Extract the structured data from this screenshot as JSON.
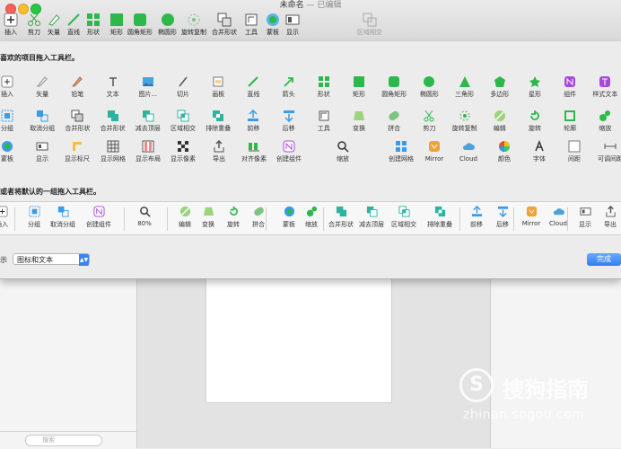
{
  "window": {
    "title": "未命名",
    "subtitle": "— 已编辑"
  },
  "toolbar": {
    "items": [
      "插入",
      "剪刀",
      "矢量",
      "直线",
      "形状",
      "矩形",
      "圆角矩形",
      "椭圆形",
      "旋转复制",
      "合并形状",
      "工具",
      "蒙板",
      "显示"
    ],
    "right_item": "区域相交"
  },
  "sheet": {
    "instruction_top": "喜欢的项目拖入工具栏。",
    "instruction_default": "或者将默认的一组拖入工具栏。",
    "row1": [
      "插入",
      "矢量",
      "铅笔",
      "文本",
      "图片...",
      "切片",
      "画板",
      "直线",
      "箭头",
      "形状",
      "矩形",
      "圆角矩形",
      "椭圆形",
      "三角形",
      "多边形",
      "星形",
      "组件",
      "样式文本"
    ],
    "row2": [
      "分组",
      "取消分组",
      "合并形状",
      "合并形状",
      "减去顶层",
      "区域相交",
      "排除重叠",
      "前移",
      "后移",
      "工具",
      "变换",
      "拼合",
      "剪刀",
      "旋转复制",
      "编辑",
      "旋转",
      "轮廓",
      "缩放"
    ],
    "row3": [
      "蒙板",
      "显示",
      "显示标尺",
      "显示网格",
      "显示布局",
      "显示像素",
      "导出",
      "对齐像素",
      "创建组件",
      "缩放",
      "创建网格",
      "Mirror",
      "Cloud",
      "颜色",
      "字体",
      "间距",
      "可调间距"
    ],
    "zoom_label": "缩放",
    "default_bar": [
      "插入",
      "分组",
      "取消分组",
      "创建组件",
      "80%",
      "编辑",
      "变换",
      "旋转",
      "拼合",
      "蒙板",
      "缩放",
      "合并形状",
      "减去顶层",
      "区域相交",
      "排除重叠",
      "前移",
      "后移",
      "Mirror",
      "Cloud",
      "显示",
      "导出"
    ],
    "show_label": "示",
    "show_value": "图标和文本",
    "done_label": "完成"
  },
  "search": {
    "placeholder": "搜索"
  },
  "watermark": {
    "brand": "搜狗指南",
    "url": "zhinan.sogou.com"
  },
  "colors": {
    "accent": "#2f7ff0",
    "green": "#2db84b",
    "teal": "#2bb5a0"
  }
}
